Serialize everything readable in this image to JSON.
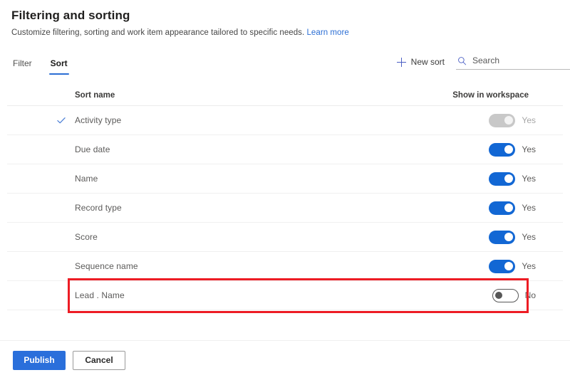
{
  "header": {
    "title": "Filtering and sorting",
    "subtitle": "Customize filtering, sorting and work item appearance tailored to specific needs.",
    "learn_more": "Learn more"
  },
  "tabs": [
    {
      "label": "Filter",
      "active": false
    },
    {
      "label": "Sort",
      "active": true
    }
  ],
  "toolbar": {
    "new_sort_label": "New sort",
    "plus_icon": "plus-icon",
    "search_icon": "search-icon",
    "search_value": "",
    "search_placeholder": "Search"
  },
  "table": {
    "columns": [
      "Sort name",
      "Show in workspace"
    ],
    "rows": [
      {
        "name": "Activity type",
        "checked": true,
        "toggle_state": "on",
        "toggle_label": "Yes",
        "disabled": true,
        "highlighted": false
      },
      {
        "name": "Due date",
        "checked": false,
        "toggle_state": "on",
        "toggle_label": "Yes",
        "disabled": false,
        "highlighted": false
      },
      {
        "name": "Name",
        "checked": false,
        "toggle_state": "on",
        "toggle_label": "Yes",
        "disabled": false,
        "highlighted": false
      },
      {
        "name": "Record type",
        "checked": false,
        "toggle_state": "on",
        "toggle_label": "Yes",
        "disabled": false,
        "highlighted": false
      },
      {
        "name": "Score",
        "checked": false,
        "toggle_state": "on",
        "toggle_label": "Yes",
        "disabled": false,
        "highlighted": false
      },
      {
        "name": "Sequence name",
        "checked": false,
        "toggle_state": "on",
        "toggle_label": "Yes",
        "disabled": false,
        "highlighted": false
      },
      {
        "name": "Lead . Name",
        "checked": false,
        "toggle_state": "off",
        "toggle_label": "No",
        "disabled": false,
        "highlighted": true
      }
    ]
  },
  "footer": {
    "publish_label": "Publish",
    "cancel_label": "Cancel"
  },
  "colors": {
    "accent_blue": "#2b6ed4",
    "toggle_on": "#1267d4",
    "toggle_disabled": "#c8c8c8",
    "primary_button": "#2a6fdb",
    "highlight_red": "#ed1c24",
    "link_blue": "#2b6ed4"
  }
}
